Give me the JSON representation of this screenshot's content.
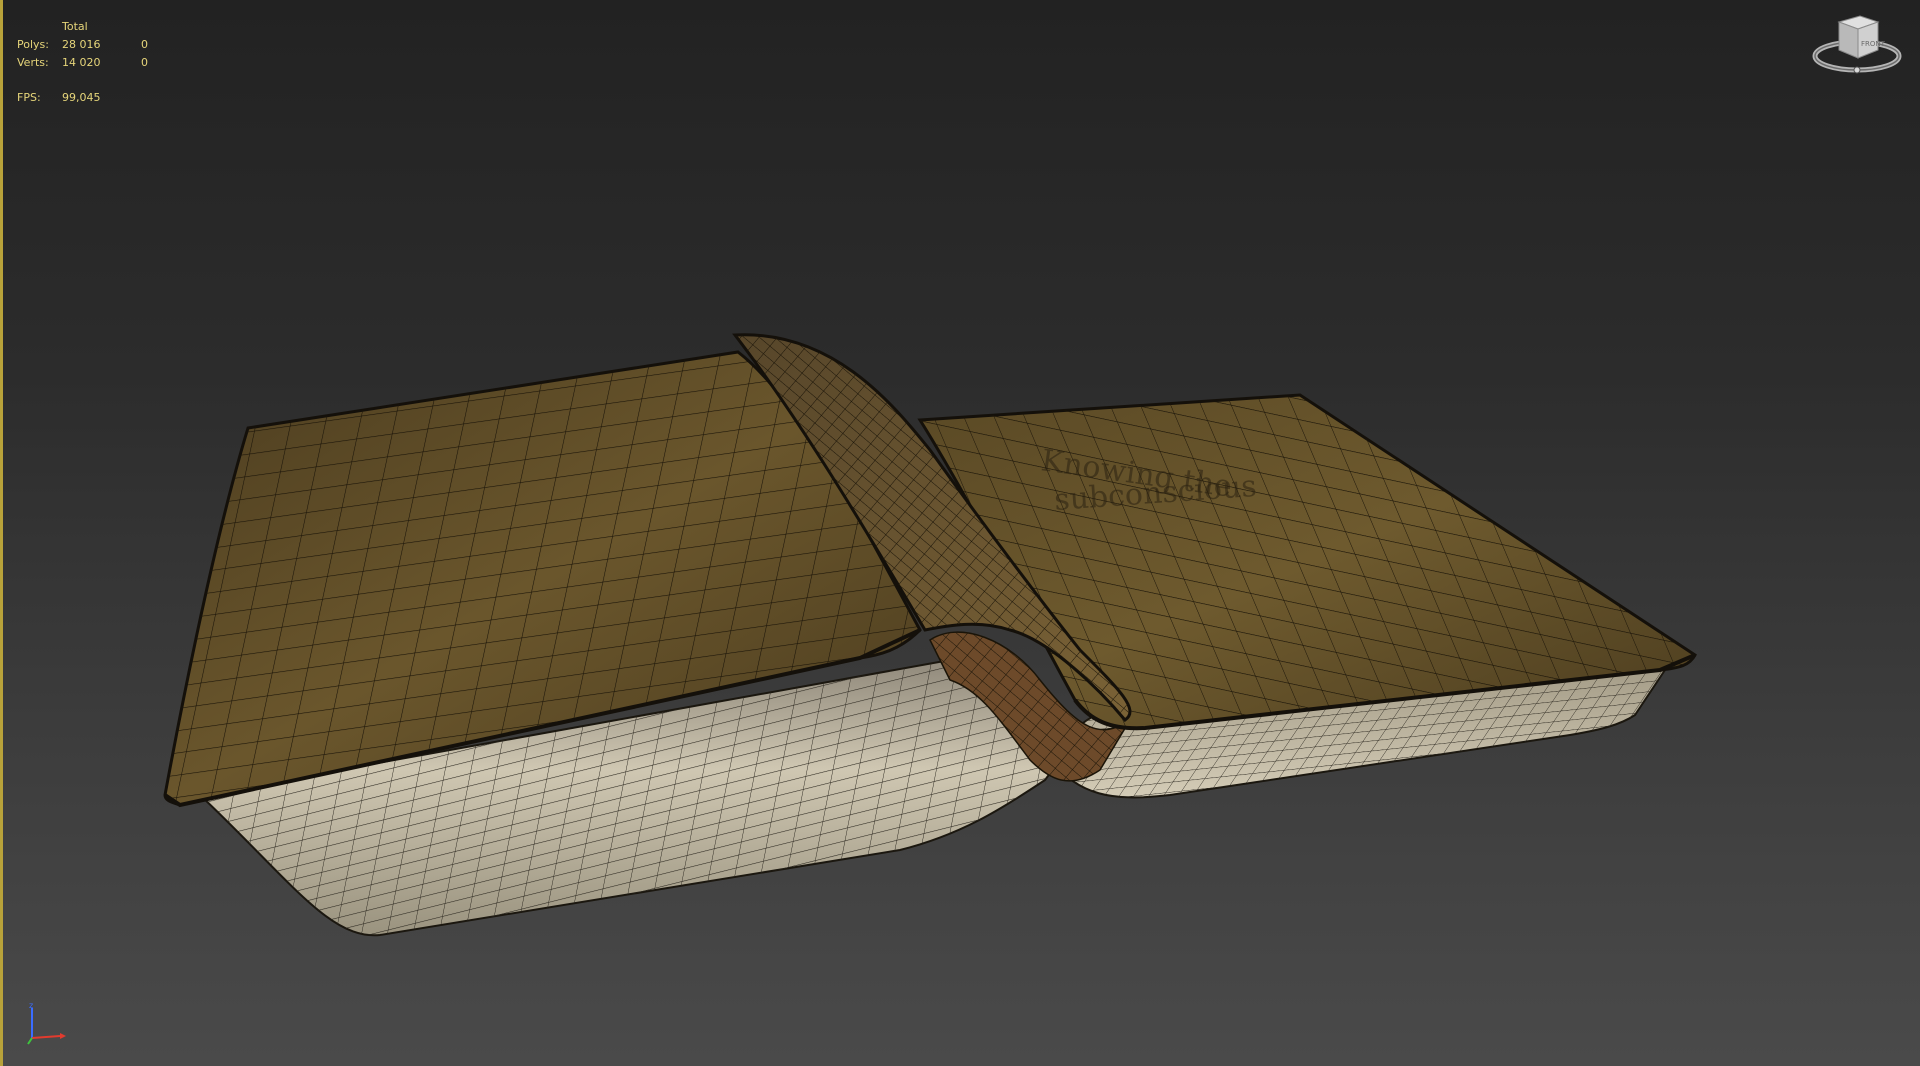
{
  "statistics": {
    "header": "Total",
    "polys_label": "Polys:",
    "polys_total": "28 016",
    "polys_selected": "0",
    "verts_label": "Verts:",
    "verts_total": "14 020",
    "verts_selected": "0",
    "fps_label": "FPS:",
    "fps_value": "99,045"
  },
  "viewcube": {
    "face_label": "FRONT",
    "icon": "viewcube-icon"
  },
  "axis_tripod": {
    "icon": "axis-tripod-icon"
  },
  "model": {
    "object": "open-book-wireframe",
    "cover_text_line1": "Knowing the",
    "cover_text_line2": "subconscious"
  },
  "colors": {
    "stats_text": "#e6d57a",
    "viewport_border": "#b8a23a",
    "cover": "#5c4a26",
    "pages": "#c8c0ac",
    "wire": "#1a1408"
  }
}
